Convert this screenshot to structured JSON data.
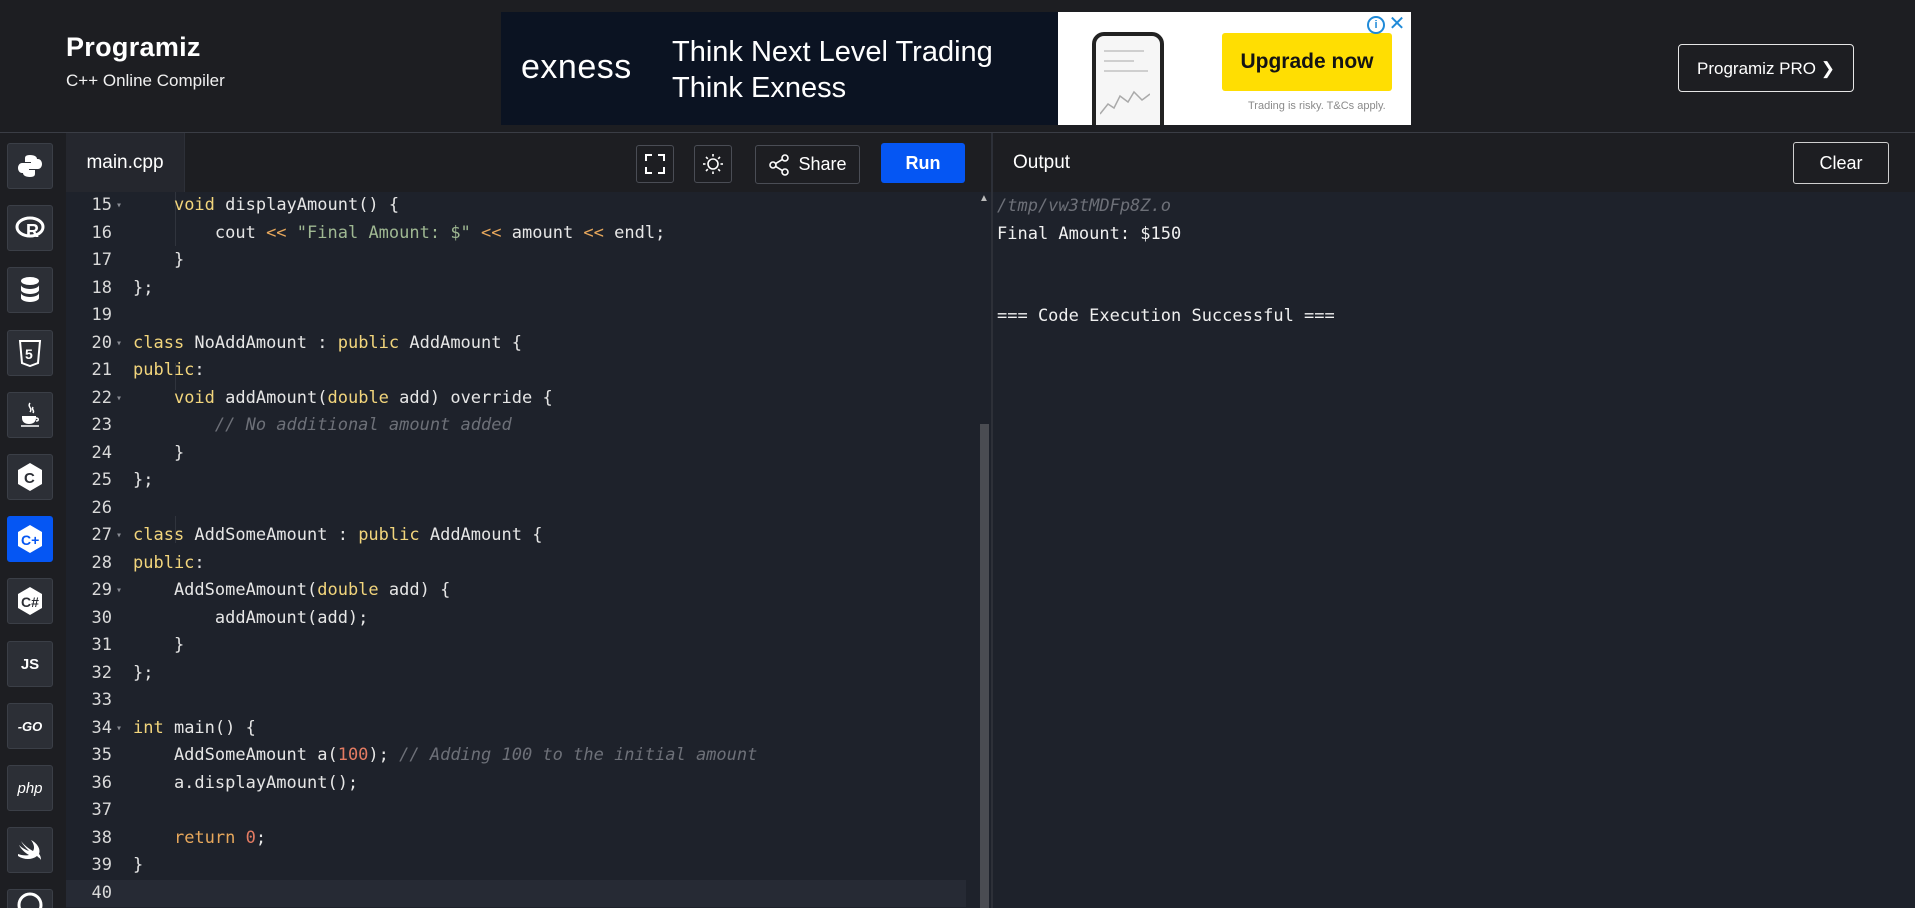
{
  "header": {
    "brand_name": "Programiz",
    "brand_subtitle": "C++ Online Compiler",
    "pro_button": "Programiz PRO ❯"
  },
  "ad": {
    "logo": "exness",
    "headline_1": "Think Next Level Trading",
    "headline_2": "Think Exness",
    "cta": "Upgrade now",
    "disclaimer": "Trading is risky. T&Cs apply.",
    "info_icon": "i",
    "close_icon": "✕"
  },
  "sidebar": {
    "items": [
      {
        "name": "python",
        "glyph": "Py",
        "active": false
      },
      {
        "name": "r",
        "glyph": "R",
        "active": false
      },
      {
        "name": "sql",
        "glyph": "DB",
        "active": false
      },
      {
        "name": "html",
        "glyph": "5",
        "active": false
      },
      {
        "name": "java",
        "glyph": "☕",
        "active": false
      },
      {
        "name": "c",
        "glyph": "C",
        "active": false
      },
      {
        "name": "cpp",
        "glyph": "C+",
        "active": true
      },
      {
        "name": "csharp",
        "glyph": "C#",
        "active": false
      },
      {
        "name": "js",
        "glyph": "JS",
        "active": false
      },
      {
        "name": "go",
        "glyph": "-GO",
        "active": false
      },
      {
        "name": "php",
        "glyph": "php",
        "active": false
      },
      {
        "name": "swift",
        "glyph": "➶",
        "active": false
      }
    ]
  },
  "editor": {
    "file_tab": "main.cpp",
    "share_label": "Share",
    "run_label": "Run",
    "lines": [
      {
        "n": "15",
        "fold": true,
        "code": "    <span class='ty'>void</span> displayAmount() {"
      },
      {
        "n": "16",
        "fold": false,
        "code": "        cout <span class='op'>&lt;&lt;</span> <span class='str'>\"Final Amount: $\"</span> <span class='op'>&lt;&lt;</span> amount <span class='op'>&lt;&lt;</span> endl;"
      },
      {
        "n": "17",
        "fold": false,
        "code": "    }"
      },
      {
        "n": "18",
        "fold": false,
        "code": "};"
      },
      {
        "n": "19",
        "fold": false,
        "code": ""
      },
      {
        "n": "20",
        "fold": true,
        "code": "<span class='kw'>class</span> NoAddAmount : <span class='kw'>public</span> AddAmount {"
      },
      {
        "n": "21",
        "fold": false,
        "code": "<span class='kw'>public</span>:"
      },
      {
        "n": "22",
        "fold": true,
        "code": "    <span class='ty'>void</span> addAmount(<span class='ty'>double</span> add) override {"
      },
      {
        "n": "23",
        "fold": false,
        "code": "        <span class='cm'>// No additional amount added</span>"
      },
      {
        "n": "24",
        "fold": false,
        "code": "    }"
      },
      {
        "n": "25",
        "fold": false,
        "code": "};"
      },
      {
        "n": "26",
        "fold": false,
        "code": ""
      },
      {
        "n": "27",
        "fold": true,
        "code": "<span class='kw'>class</span> AddSomeAmount : <span class='kw'>public</span> AddAmount {"
      },
      {
        "n": "28",
        "fold": false,
        "code": "<span class='kw'>public</span>:"
      },
      {
        "n": "29",
        "fold": true,
        "code": "    AddSomeAmount(<span class='ty'>double</span> add) {"
      },
      {
        "n": "30",
        "fold": false,
        "code": "        addAmount(add);"
      },
      {
        "n": "31",
        "fold": false,
        "code": "    }"
      },
      {
        "n": "32",
        "fold": false,
        "code": "};"
      },
      {
        "n": "33",
        "fold": false,
        "code": ""
      },
      {
        "n": "34",
        "fold": true,
        "code": "<span class='ty'>int</span> main() {"
      },
      {
        "n": "35",
        "fold": false,
        "code": "    AddSomeAmount a(<span class='num'>100</span>); <span class='cm'>// Adding 100 to the initial amount</span>"
      },
      {
        "n": "36",
        "fold": false,
        "code": "    a.displayAmount();"
      },
      {
        "n": "37",
        "fold": false,
        "code": ""
      },
      {
        "n": "38",
        "fold": false,
        "code": "    <span class='op'>return</span> <span class='num'>0</span>;"
      },
      {
        "n": "39",
        "fold": false,
        "code": "}"
      },
      {
        "n": "40",
        "fold": false,
        "code": "",
        "current": true
      }
    ]
  },
  "output": {
    "title": "Output",
    "clear_label": "Clear",
    "path": "/tmp/vw3tMDFp8Z.o",
    "result": "Final Amount: $150",
    "status": "=== Code Execution Successful ==="
  }
}
